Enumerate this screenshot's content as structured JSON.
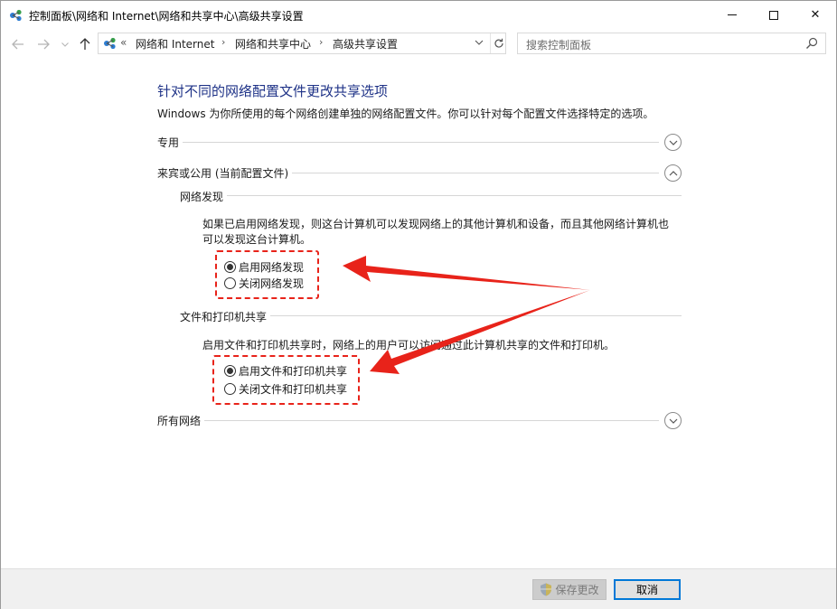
{
  "window": {
    "title": "控制面板\\网络和 Internet\\网络和共享中心\\高级共享设置",
    "controls": {
      "minimize": "minimize",
      "maximize": "maximize",
      "close": "✕"
    }
  },
  "nav": {
    "overflow": "«",
    "breadcrumbs": [
      "网络和 Internet",
      "网络和共享中心",
      "高级共享设置"
    ],
    "separator": "›"
  },
  "search": {
    "placeholder": "搜索控制面板"
  },
  "main": {
    "heading": "针对不同的网络配置文件更改共享选项",
    "description": "Windows 为你所使用的每个网络创建单独的网络配置文件。你可以针对每个配置文件选择特定的选项。",
    "profiles": {
      "private": {
        "label": "专用",
        "expanded": false
      },
      "guest_public": {
        "label": "来宾或公用 (当前配置文件)",
        "expanded": true,
        "network_discovery": {
          "title": "网络发现",
          "text_line1": "如果已启用网络发现，则这台计算机可以发现网络上的其他计算机和设备，而且其他网络计算机也",
          "text_line2": "可以发现这台计算机。",
          "options": [
            {
              "label": "启用网络发现",
              "selected": true
            },
            {
              "label": "关闭网络发现",
              "selected": false
            }
          ]
        },
        "file_printer_sharing": {
          "title": "文件和打印机共享",
          "text": "启用文件和打印机共享时，网络上的用户可以访问通过此计算机共享的文件和打印机。",
          "options": [
            {
              "label": "启用文件和打印机共享",
              "selected": true
            },
            {
              "label": "关闭文件和打印机共享",
              "selected": false
            }
          ]
        }
      },
      "all_networks": {
        "label": "所有网络",
        "expanded": false
      }
    }
  },
  "footer": {
    "save_label": "保存更改",
    "cancel_label": "取消"
  },
  "colors": {
    "heading": "#1e3287",
    "annotation": "#e8231a",
    "accent": "#0078d7"
  }
}
